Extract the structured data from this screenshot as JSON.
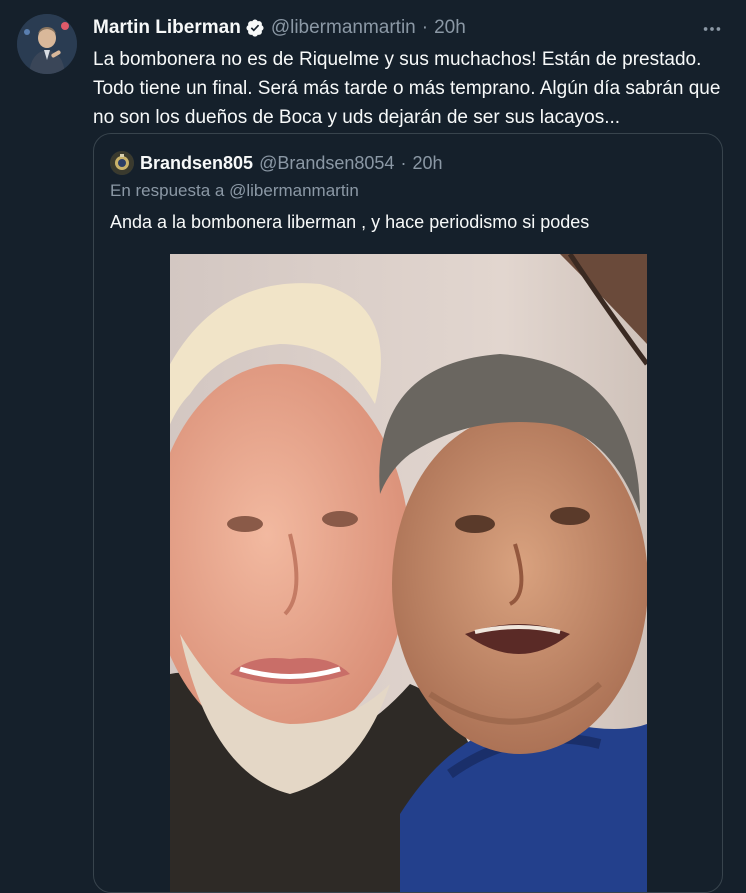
{
  "tweet": {
    "author_name": "Martin Liberman",
    "author_handle": "@libermanmartin",
    "separator": "·",
    "time": "20h",
    "text_lines": [
      "La bombonera no es de Riquelme y sus muchachos! Están de prestado.",
      "Todo tiene un final. Será más tarde o más temprano. Algún día sabrán que",
      "no son los dueños de Boca y uds dejarán de ser sus lacayos..."
    ],
    "more_icon": "more-horizontal-icon",
    "verified_icon": "verified-badge-icon"
  },
  "quoted": {
    "author_name": "Brandsen805",
    "author_handle": "@Brandsen8054",
    "separator": "·",
    "time": "20h",
    "reply_prefix": "En respuesta a",
    "reply_mention": "@libermanmartin",
    "text": "Anda a la bombonera liberman , y hace periodismo si podes"
  },
  "colors": {
    "background": "#15202b",
    "text_primary": "#f7f9f9",
    "text_secondary": "#8b98a5",
    "border": "#38444d",
    "verified": "#1d9bf0"
  }
}
